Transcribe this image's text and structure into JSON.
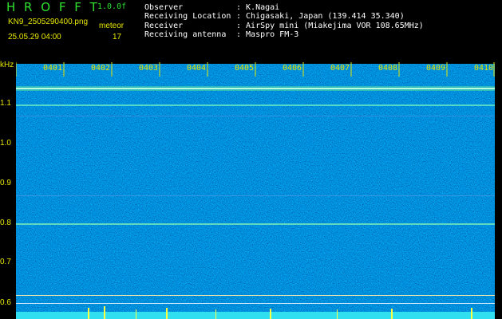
{
  "app": {
    "title": "H R O F F T",
    "version": "1.0.0f",
    "filename": "KN9_2505290400.png",
    "datetime": "25.05.29 04:00",
    "meteor_label": "meteor",
    "meteor_count": "17"
  },
  "info": {
    "observer_label": "Observer",
    "observer_value": ": K.Nagai",
    "location_label": "Receiving Location",
    "location_value": ": Chigasaki, Japan (139.414 35.340)",
    "receiver_label": "Receiver",
    "receiver_value": ": AirSpy mini (Miakejima VOR 108.65MHz)",
    "antenna_label": "Receiving antenna",
    "antenna_value": ": Maspro FM-3"
  },
  "axis": {
    "unit": "kHz",
    "hours": [
      "0401",
      "0402",
      "0403",
      "0404",
      "0405",
      "0406",
      "0407",
      "0408",
      "0409",
      "0410"
    ],
    "yticks": [
      "1.1",
      "1.0",
      "0.9",
      "0.8",
      "0.7",
      "0.6"
    ]
  },
  "colors": {
    "background": "#000000",
    "noise_bg": "#00007a",
    "text_green": "#2fe02f",
    "text_yellow": "#e6e600",
    "signal": "#5ee6c8"
  }
}
